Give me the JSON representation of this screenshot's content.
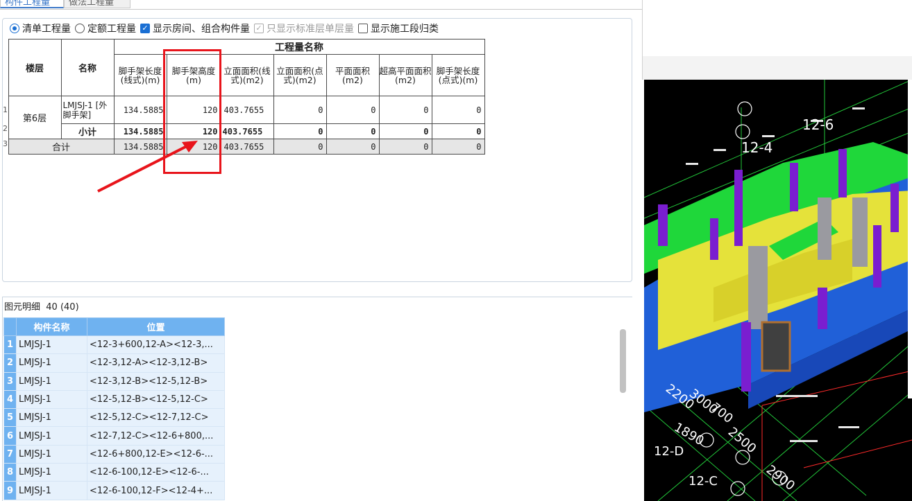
{
  "tabs": [
    "构件工程量",
    "做法工程量"
  ],
  "options": {
    "qingdan": "清单工程量",
    "dinge": "定额工程量",
    "show_room": "显示房间、组合构件量",
    "only_std": "只显示标准层单层量",
    "show_stage": "显示施工段归类"
  },
  "table": {
    "col_floor": "楼层",
    "col_name": "名称",
    "group_header": "工程量名称",
    "cols": [
      "脚手架长度(线式)(m)",
      "脚手架高度(m)",
      "立面面积(线式)(m2)",
      "立面面积(点式)(m2)",
      "平面面积(m2)",
      "超高平面面积(m2)",
      "脚手架长度(点式)(m)"
    ],
    "rows": [
      {
        "rn": "1",
        "floor": "第6层",
        "name": "LMJSJ-1 [外脚手架]",
        "values": [
          "134.5885",
          "120",
          "403.7655",
          "0",
          "0",
          "0",
          "0"
        ]
      },
      {
        "rn": "2",
        "label": "小计",
        "values": [
          "134.5885",
          "120",
          "403.7655",
          "0",
          "0",
          "0",
          "0"
        ]
      },
      {
        "rn": "3",
        "label": "合计",
        "values": [
          "134.5885",
          "120",
          "403.7655",
          "0",
          "0",
          "0",
          "0"
        ]
      }
    ]
  },
  "detail": {
    "title": "图元明细",
    "count": "40 (40)",
    "col_name": "构件名称",
    "col_pos": "位置",
    "rows": [
      {
        "n": "1",
        "name": "LMJSJ-1",
        "pos": "<12-3+600,12-A><12-3,..."
      },
      {
        "n": "2",
        "name": "LMJSJ-1",
        "pos": "<12-3,12-A><12-3,12-B>"
      },
      {
        "n": "3",
        "name": "LMJSJ-1",
        "pos": "<12-3,12-B><12-5,12-B>"
      },
      {
        "n": "4",
        "name": "LMJSJ-1",
        "pos": "<12-5,12-B><12-5,12-C>"
      },
      {
        "n": "5",
        "name": "LMJSJ-1",
        "pos": "<12-5,12-C><12-7,12-C>"
      },
      {
        "n": "6",
        "name": "LMJSJ-1",
        "pos": "<12-7,12-C><12-6+800,..."
      },
      {
        "n": "7",
        "name": "LMJSJ-1",
        "pos": "<12-6+800,12-E><12-6-..."
      },
      {
        "n": "8",
        "name": "LMJSJ-1",
        "pos": "<12-6-100,12-E><12-6-..."
      },
      {
        "n": "9",
        "name": "LMJSJ-1",
        "pos": "<12-6-100,12-F><12-4+..."
      }
    ]
  },
  "cad_labels": [
    "12-6",
    "12-4",
    "12-D",
    "12-C",
    "2200",
    "3000",
    "700",
    "1890",
    "2500",
    "2900"
  ],
  "colors": {
    "highlight": "#e8141b",
    "accent": "#1a6fd3",
    "header_blue": "#6fb2f0"
  }
}
